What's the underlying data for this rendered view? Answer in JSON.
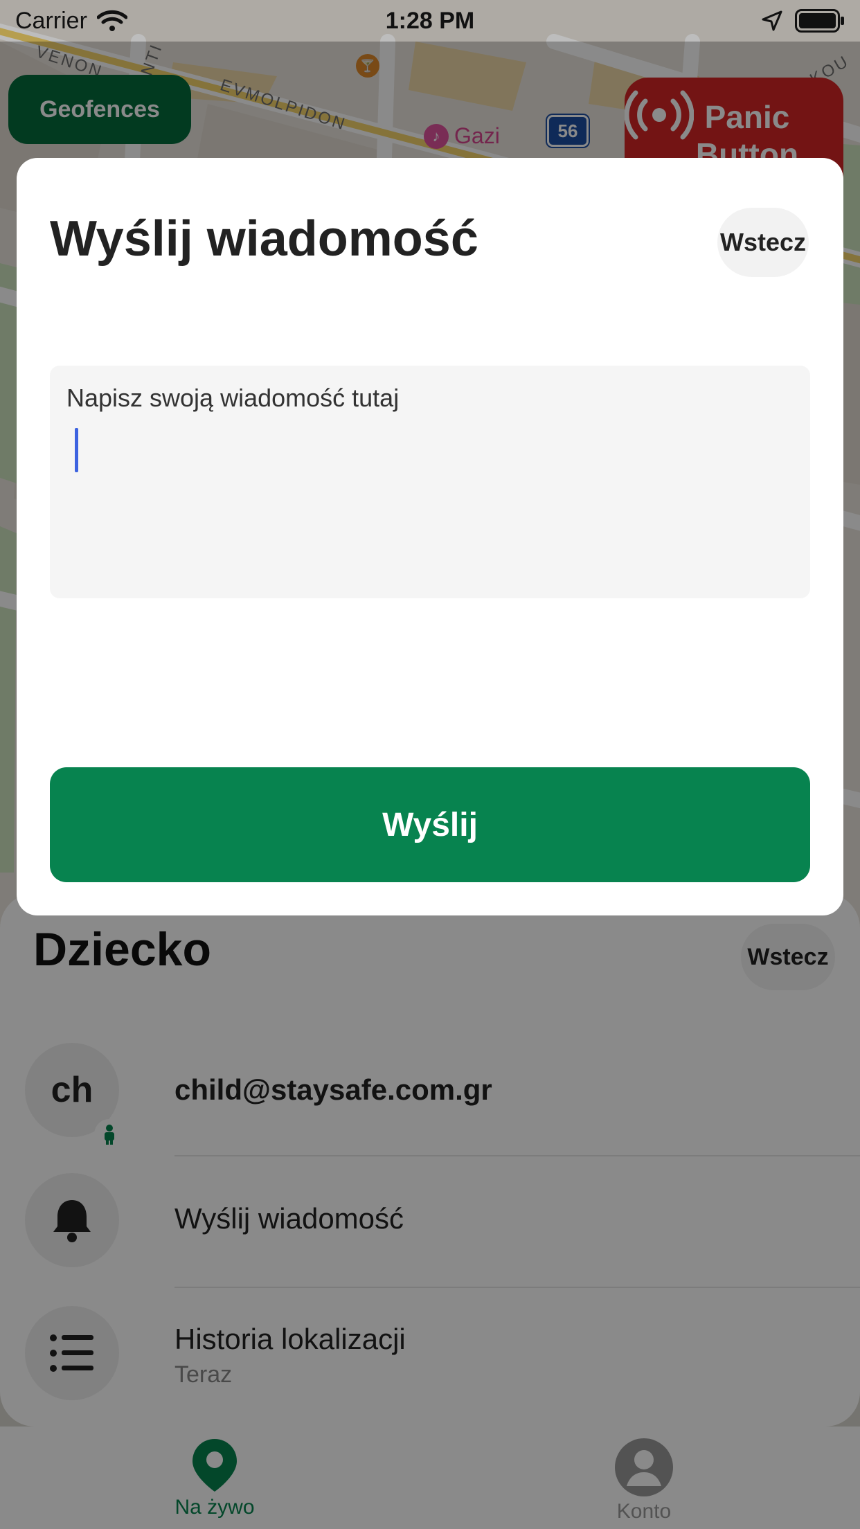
{
  "status_bar": {
    "carrier": "Carrier",
    "time": "1:28 PM"
  },
  "map": {
    "labels": [
      "VENON",
      "EVMOLPIDON",
      "NTI",
      "KOU"
    ],
    "poi_gazi": "Gazi",
    "bus_route": "56"
  },
  "map_controls": {
    "geofences": "Geofences",
    "panic_button": "Panic Button"
  },
  "sheet": {
    "title": "Dziecko",
    "back": "Wstecz",
    "child": {
      "avatar_initials": "ch",
      "email": "child@staysafe.com.gr"
    },
    "send_message": "Wyślij wiadomość",
    "history": {
      "label": "Historia lokalizacji",
      "sub": "Teraz"
    }
  },
  "tabbar": {
    "live": "Na żywo",
    "account": "Konto"
  },
  "modal": {
    "title": "Wyślij wiadomość",
    "back": "Wstecz",
    "placeholder": "Napisz swoją wiadomość tutaj",
    "send": "Wyślij"
  },
  "colors": {
    "brand_green": "#07834f",
    "geofence_green": "#056b3c",
    "panic_red": "#d42525",
    "caret_blue": "#3d63e0"
  }
}
